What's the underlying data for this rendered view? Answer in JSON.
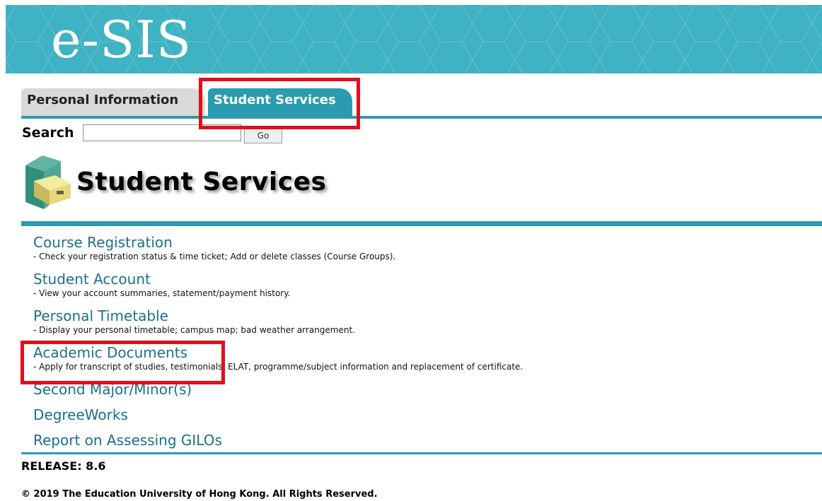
{
  "banner": {
    "logo_text": "e-SIS"
  },
  "tabs": [
    {
      "label": "Personal Information",
      "active": false
    },
    {
      "label": "Student Services",
      "active": true
    }
  ],
  "search": {
    "label": "Search",
    "value": "",
    "go_label": "Go"
  },
  "page": {
    "title": "Student Services",
    "icon": "file-cabinet-icon"
  },
  "menu": [
    {
      "label": "Course Registration",
      "desc": "- Check your registration status & time ticket; Add or delete classes (Course Groups)."
    },
    {
      "label": "Student Account",
      "desc": "- View your account summaries, statement/payment history."
    },
    {
      "label": "Personal Timetable",
      "desc": "- Display your personal timetable; campus map; bad weather arrangement."
    },
    {
      "label": "Academic Documents",
      "desc": "- Apply for transcript of studies, testimonials, ELAT, programme/subject information and replacement of certificate."
    },
    {
      "label": "Second Major/Minor(s)"
    },
    {
      "label": "DegreeWorks"
    },
    {
      "label": "Report on Assessing GILOs"
    }
  ],
  "footer": {
    "release": "RELEASE: 8.6",
    "copyright": "© 2019 The Education University of Hong Kong. All Rights Reserved."
  },
  "colors": {
    "banner": "#3fb2c3",
    "accent": "#2b9cb0",
    "link": "#1b6f8c",
    "highlight": "#e0101b"
  }
}
